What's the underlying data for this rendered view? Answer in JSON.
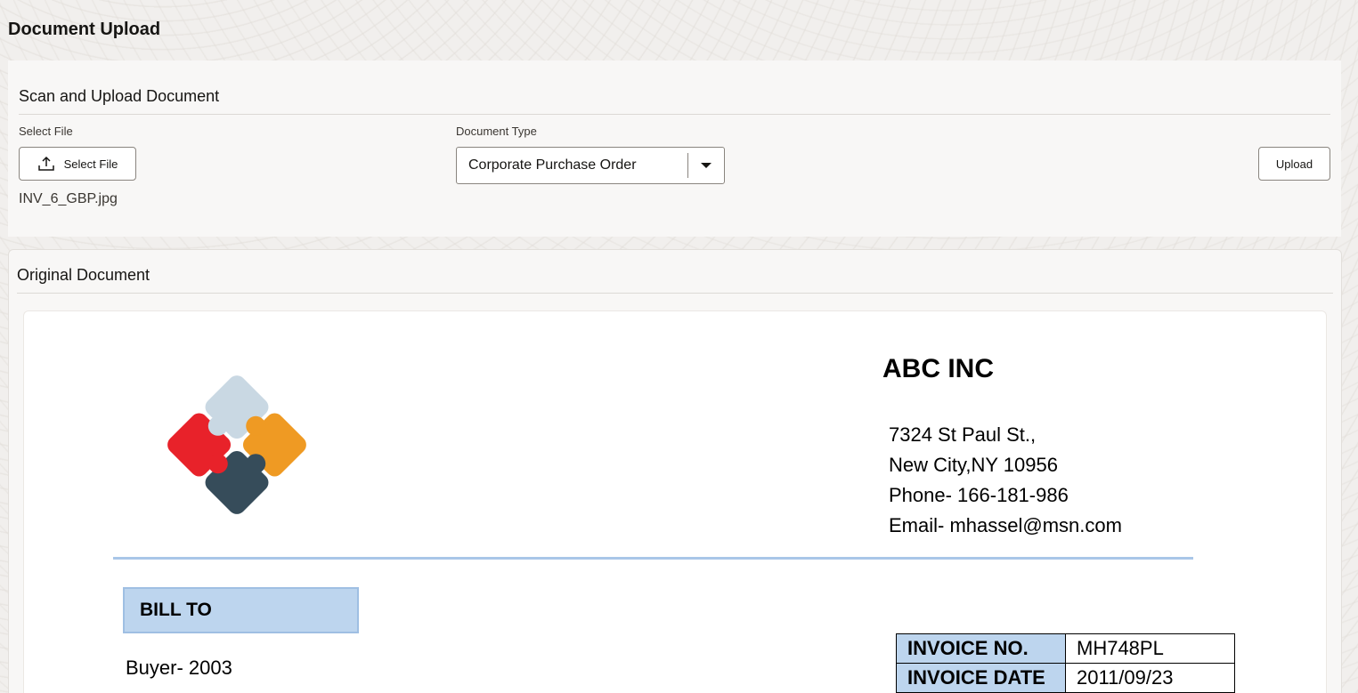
{
  "page": {
    "title": "Document Upload"
  },
  "scan_section": {
    "title": "Scan and Upload Document",
    "select_file_label": "Select File",
    "select_file_button": "Select File",
    "selected_file_name": "INV_6_GBP.jpg",
    "document_type_label": "Document Type",
    "document_type_value": "Corporate Purchase Order",
    "upload_button": "Upload"
  },
  "original_document": {
    "title": "Original Document",
    "invoice": {
      "company_name": "ABC INC",
      "address_lines": [
        "7324 St Paul St.,",
        "New City,NY 10956",
        "Phone- 166-181-986",
        "Email- mhassel@msn.com"
      ],
      "bill_to_label": "BILL TO",
      "buyer": "Buyer- 2003",
      "fields": [
        {
          "key": "INVOICE NO.",
          "value": "MH748PL"
        },
        {
          "key": "INVOICE DATE",
          "value": "2011/09/23"
        }
      ],
      "logo_colors": {
        "top": "#c9d8e3",
        "right": "#ef9a23",
        "bottom": "#364c5a",
        "left": "#e8222a"
      },
      "accent_color": "#bdd5ee"
    }
  }
}
